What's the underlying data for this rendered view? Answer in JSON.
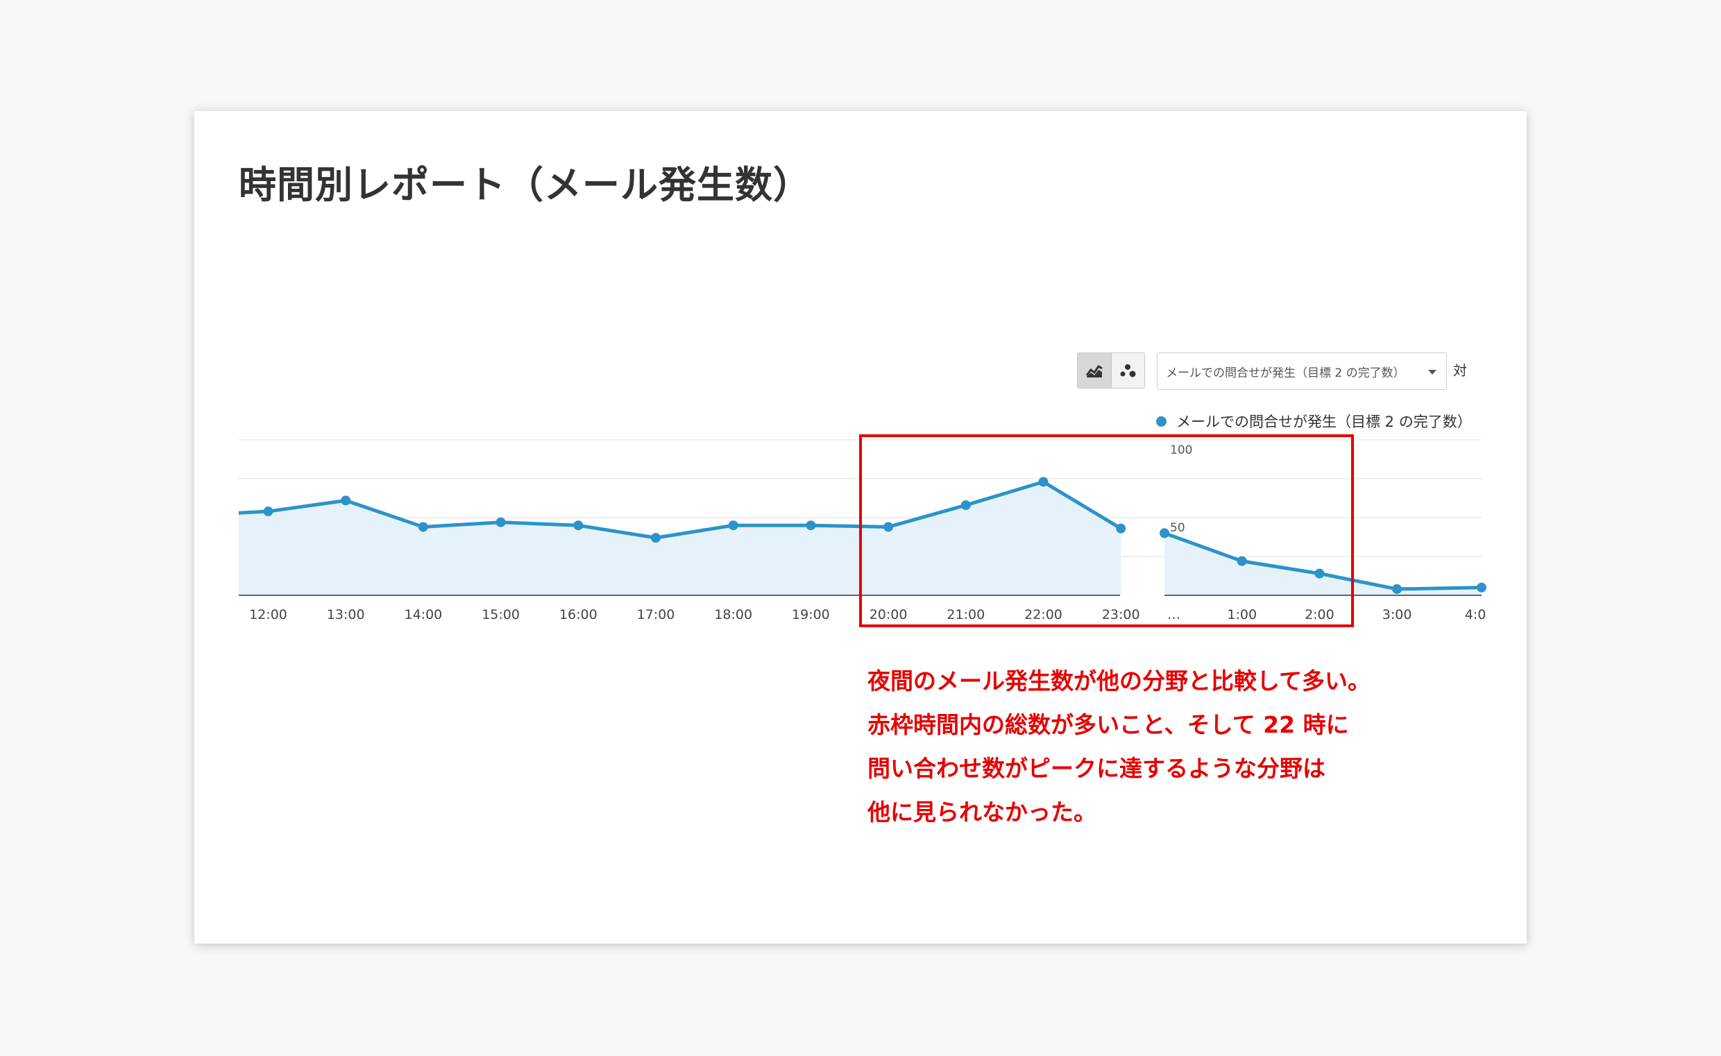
{
  "slide": {
    "title": "時間別レポート（メール発生数）",
    "annotation_lines": [
      "夜間のメール発生数が他の分野と比較して多い。",
      "赤枠時間内の総数が多いこと、そして 22 時に",
      "問い合わせ数がピークに達するような分野は",
      "他に見られなかった。"
    ],
    "annotation_color": "#e60000"
  },
  "toolbar": {
    "chart_type_buttons": [
      {
        "icon": "line-chart-icon",
        "active": true
      },
      {
        "icon": "motion-chart-icon",
        "active": false
      }
    ],
    "metric_select": "メールでの問合せが発生（目標 2 の完了数）",
    "versus_label": "対"
  },
  "chart_data": {
    "type": "area",
    "x": [
      "12:00",
      "13:00",
      "14:00",
      "15:00",
      "16:00",
      "17:00",
      "18:00",
      "19:00",
      "20:00",
      "21:00",
      "22:00",
      "23:00",
      "…",
      "1:00",
      "2:00",
      "3:00",
      "4:0"
    ],
    "series": [
      {
        "name": "メールでの問合せが発生（目標 2 の完了数）",
        "color": "#2b93c9",
        "segments": [
          {
            "x": [
              "11:30",
              "12:00",
              "13:00",
              "14:00",
              "15:00",
              "16:00",
              "17:00",
              "18:00",
              "19:00",
              "20:00",
              "21:00",
              "22:00",
              "23:00"
            ],
            "values": [
              53,
              54,
              61,
              44,
              47,
              45,
              37,
              45,
              45,
              44,
              58,
              73,
              43
            ],
            "markers_from": 1
          },
          {
            "x": [
              "0:00",
              "1:00",
              "2:00",
              "3:00",
              "4:00"
            ],
            "values": [
              40,
              22,
              14,
              4,
              5
            ],
            "markers_from": 0
          }
        ]
      }
    ],
    "yticks": [
      "100",
      "50"
    ],
    "ylim": [
      0,
      100
    ],
    "grid": true,
    "legend": "top-right"
  }
}
